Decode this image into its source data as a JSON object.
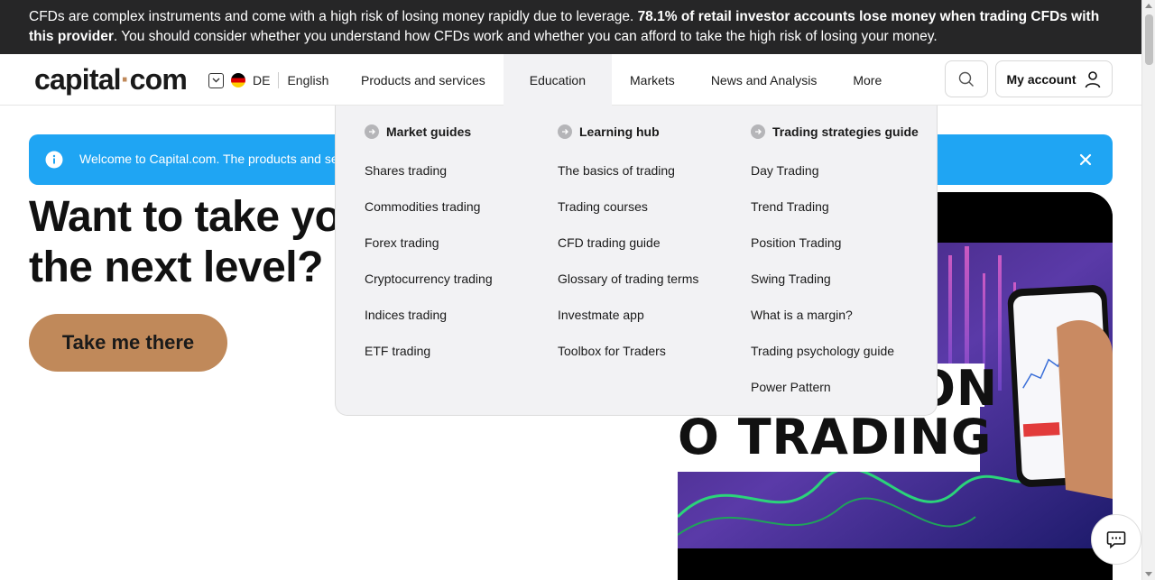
{
  "risk_banner": {
    "text_before": "CFDs are complex instruments and come with a high risk of losing money rapidly due to leverage. ",
    "text_bold": "78.1% of retail investor accounts lose money when trading CFDs with this provider",
    "text_after": ". You should consider whether you understand how CFDs work and whether you can afford to take the high risk of losing your money."
  },
  "header": {
    "logo_part1": "capital",
    "logo_dot": "·",
    "logo_part2": "com",
    "country_code": "DE",
    "language": "English",
    "nav": [
      {
        "label": "Products and services"
      },
      {
        "label": "Education"
      },
      {
        "label": "Markets"
      },
      {
        "label": "News and Analysis"
      },
      {
        "label": "More"
      }
    ],
    "account_label": "My account"
  },
  "info_bar": {
    "text": "Welcome to Capital.com. The products and serv"
  },
  "hero": {
    "title_line1": "Want to take yo",
    "title_line2": "the next level?",
    "cta_label": "Take me there",
    "image_text": "O TRADING",
    "image_text_partial": "ON"
  },
  "dropdown": {
    "columns": [
      {
        "heading": "Market guides",
        "links": [
          "Shares trading",
          "Commodities trading",
          "Forex trading",
          "Cryptocurrency trading",
          "Indices trading",
          "ETF trading"
        ]
      },
      {
        "heading": "Learning hub",
        "links": [
          "The basics of trading",
          "Trading courses",
          "CFD trading guide",
          "Glossary of trading terms",
          "Investmate app",
          "Toolbox for Traders"
        ]
      },
      {
        "heading": "Trading strategies guide",
        "links": [
          "Day Trading",
          "Trend Trading",
          "Position Trading",
          "Swing Trading",
          "What is a margin?",
          "Trading psychology guide",
          "Power Pattern"
        ]
      }
    ]
  },
  "colors": {
    "risk_bg": "#262627",
    "accent_brown": "#c0895a",
    "info_blue": "#1fa5f3",
    "dropdown_bg": "#f2f2f4"
  }
}
